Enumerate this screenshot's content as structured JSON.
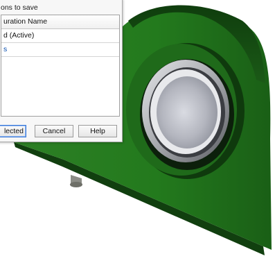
{
  "dialog": {
    "heading": "ons to save",
    "column_header": "uration Name",
    "rows": [
      {
        "label": "d (Active)"
      },
      {
        "label": "s"
      }
    ],
    "buttons": {
      "save_selected": "lected",
      "cancel": "Cancel",
      "help": "Help"
    }
  },
  "model": {
    "description_colors": {
      "body": "#1f6a1a",
      "body_dark": "#0f3d0d",
      "bearing_insert": "#b9bcc4"
    }
  }
}
